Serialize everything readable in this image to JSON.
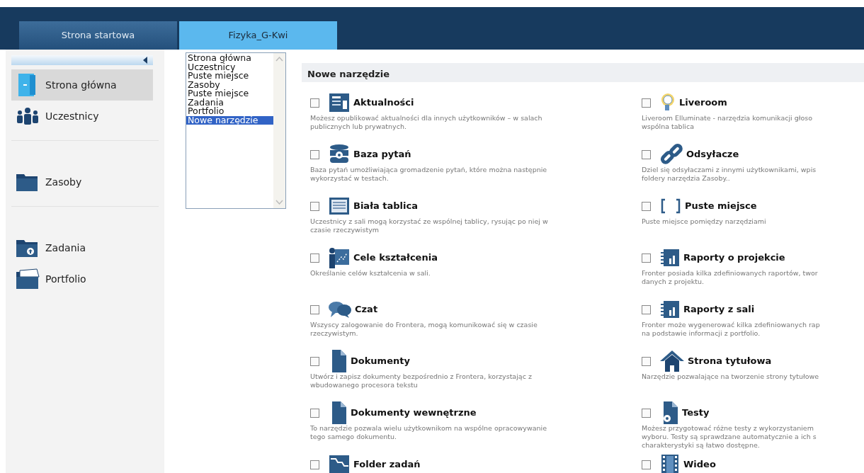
{
  "tabs": [
    {
      "label": "Strona startowa",
      "selected": false
    },
    {
      "label": "Fizyka_G-Kwi",
      "selected": true
    }
  ],
  "sidebar": {
    "groups": [
      {
        "items": [
          {
            "label": "Strona główna",
            "selected": true
          },
          {
            "label": "Uczestnicy",
            "selected": false
          }
        ]
      },
      {
        "items": [
          {
            "label": "Zasoby",
            "selected": false
          }
        ]
      },
      {
        "items": [
          {
            "label": "Zadania",
            "selected": false
          },
          {
            "label": "Portfolio",
            "selected": false
          }
        ]
      }
    ]
  },
  "listbox": {
    "options": [
      {
        "label": "Strona główna",
        "selected": false
      },
      {
        "label": "Uczestnicy",
        "selected": false
      },
      {
        "label": "Puste miejsce",
        "selected": false
      },
      {
        "label": "Zasoby",
        "selected": false
      },
      {
        "label": "Puste miejsce",
        "selected": false
      },
      {
        "label": "Zadania",
        "selected": false
      },
      {
        "label": "Portfolio",
        "selected": false
      },
      {
        "label": "Nowe narzędzie",
        "selected": true
      }
    ]
  },
  "panel": {
    "title": "Nowe narzędzie",
    "columns": [
      {
        "tools": [
          {
            "name": "Aktualności",
            "checked": false,
            "description": "Możesz opublikować aktualności dla innych użytkowników – w salach\npublicznych lub prywatnych."
          },
          {
            "name": "Baza pytań",
            "checked": false,
            "description": "Baza pytań umożliwiająca gromadzenie pytań, które można następnie\nwykorzystać w testach."
          },
          {
            "name": "Biała tablica",
            "checked": false,
            "description": "Uczestnicy z sali mogą korzystać ze wspólnej tablicy, rysując po niej w\nczasie rzeczywistym"
          },
          {
            "name": "Cele kształcenia",
            "checked": false,
            "description": "Określanie celów kształcenia w sali."
          },
          {
            "name": "Czat",
            "checked": false,
            "description": "Wszyscy zalogowanie do Frontera, mogą komunikować się w czasie\nrzeczywistym."
          },
          {
            "name": "Dokumenty",
            "checked": false,
            "description": "Utwórz i zapisz dokumenty bezpośrednio z Frontera, korzystając z\nwbudowanego procesora tekstu"
          },
          {
            "name": "Dokumenty wewnętrzne",
            "checked": false,
            "description": "To narzędzie pozwala wielu użytkownikom na wspólne opracowywanie\ntego samego dokumentu."
          },
          {
            "name": "Folder zadań",
            "checked": false
          }
        ]
      },
      {
        "tools": [
          {
            "name": "Liveroom",
            "checked": false,
            "description": "Liveroom Elluminate - narzędzia komunikacji głoso\nwspólna tablica"
          },
          {
            "name": "Odsyłacze",
            "checked": false,
            "description": "Dziel się odsyłaczami z innymi użytkownikami, wpis\nfoldery narzędzia Zasoby.."
          },
          {
            "name": "Puste miejsce",
            "checked": false,
            "description": "Puste miejsce pomiędzy narzędziami"
          },
          {
            "name": "Raporty o projekcie",
            "checked": false,
            "description": "Fronter posiada kilka zdefiniowanych raportów, twor\ndanych z projektu."
          },
          {
            "name": "Raporty z sali",
            "checked": false,
            "description": "Fronter może wygenerować kilka zdefiniowanych rap\nna podstawie informacji z portfolio."
          },
          {
            "name": "Strona tytułowa",
            "checked": false,
            "description": "Narzędzie pozwalające na tworzenie strony tytułowe"
          },
          {
            "name": "Testy",
            "checked": false,
            "description": "Możesz przygotować różne testy z wykorzystaniem\nwyboru. Testy są sprawdzane automatycznie a ich s\ncharakterystyki są łatwo dostępne."
          },
          {
            "name": "Wideo",
            "checked": false
          }
        ]
      }
    ]
  }
}
